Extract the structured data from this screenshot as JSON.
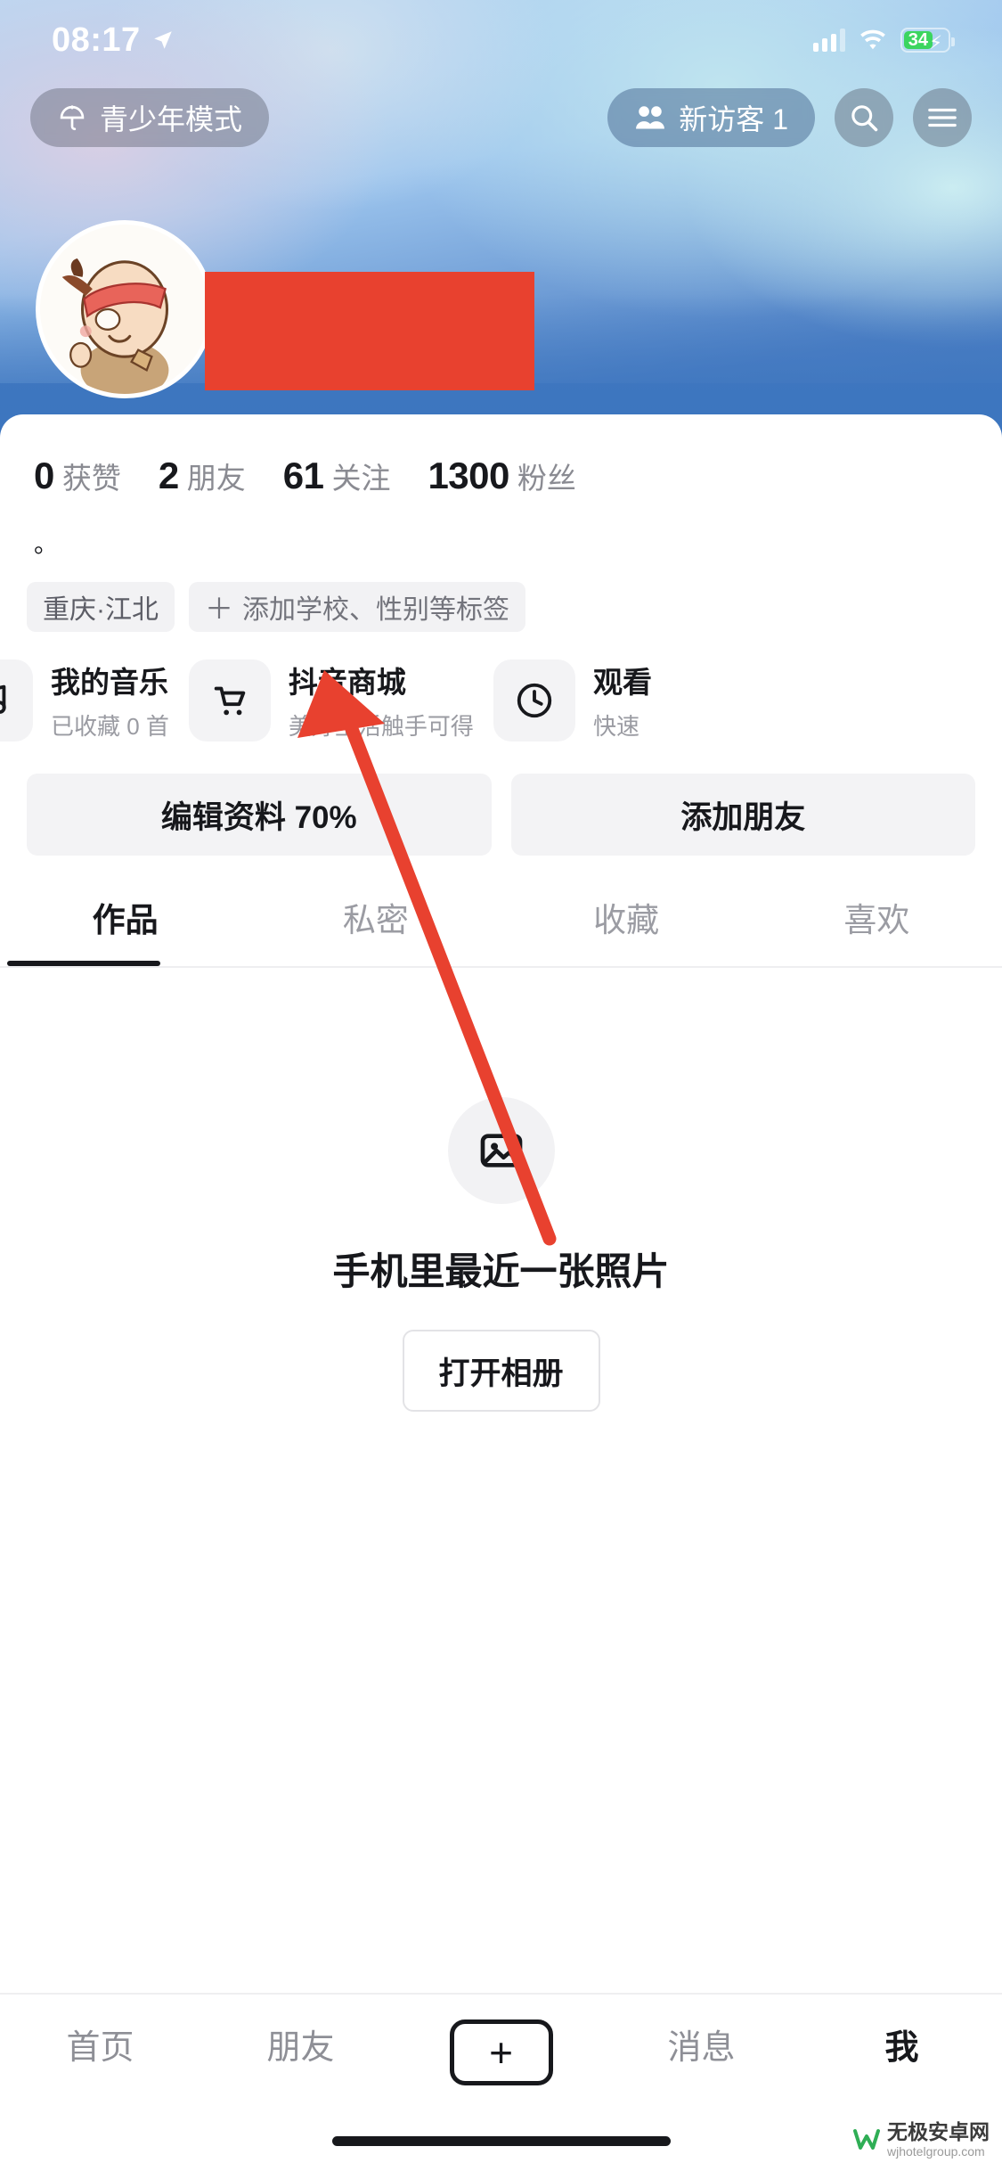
{
  "status_bar": {
    "time": "08:17",
    "battery_level": "34",
    "location_icon": "location-arrow-icon",
    "signal_icon": "cellular-bars-icon",
    "wifi_icon": "wifi-icon",
    "charging_icon": "lightning-bolt-icon"
  },
  "top_bar": {
    "teen_mode_label": "青少年模式",
    "teen_mode_icon": "umbrella-icon",
    "visitor_label": "新访客 1",
    "visitor_icon": "two-people-icon",
    "search_icon": "search-icon",
    "menu_icon": "hamburger-menu-icon"
  },
  "profile": {
    "avatar_icon": "user-avatar-cartoon",
    "name_redacted": "",
    "bio": "。",
    "stats": [
      {
        "num": "0",
        "label": "获赞"
      },
      {
        "num": "2",
        "label": "朋友"
      },
      {
        "num": "61",
        "label": "关注"
      },
      {
        "num": "1300",
        "label": "粉丝"
      }
    ],
    "tags": [
      {
        "text": "重庆·江北",
        "has_plus": false
      },
      {
        "text": "添加学校、性别等标签",
        "has_plus": true,
        "plus": "＋"
      }
    ]
  },
  "feature_cards": [
    {
      "title": "我的音乐",
      "subtitle": "已收藏 0 首",
      "icon": "music-note-icon"
    },
    {
      "title": "抖音商城",
      "subtitle": "美好生活触手可得",
      "icon": "shopping-cart-icon"
    },
    {
      "title": "观看",
      "subtitle": "快速",
      "icon": "clock-icon"
    }
  ],
  "actions": {
    "edit_profile": "编辑资料 70%",
    "add_friend": "添加朋友"
  },
  "tabs": [
    {
      "label": "作品",
      "active": true
    },
    {
      "label": "私密",
      "active": false
    },
    {
      "label": "收藏",
      "active": false
    },
    {
      "label": "喜欢",
      "active": false
    }
  ],
  "empty_state": {
    "icon": "photo-image-icon",
    "title": "手机里最近一张照片",
    "button": "打开相册"
  },
  "bottom_nav": {
    "items": [
      {
        "label": "首页",
        "active": false
      },
      {
        "label": "朋友",
        "active": false
      },
      {
        "label": "+",
        "active": false,
        "is_plus": true
      },
      {
        "label": "消息",
        "active": false
      },
      {
        "label": "我",
        "active": true
      }
    ]
  },
  "annotation": {
    "arrow_color": "#e8412f",
    "points_to": "抖音商城"
  },
  "watermark": {
    "line1": "无极安卓网",
    "line2": "wjhotelgroup.com",
    "logo_color": "#2fae55"
  },
  "colors": {
    "accent_red": "#e8412f",
    "text_primary": "#17181c",
    "text_secondary": "#8a8b92",
    "chip_bg": "#f2f2f4",
    "cover_blue": "#2a68b6"
  }
}
